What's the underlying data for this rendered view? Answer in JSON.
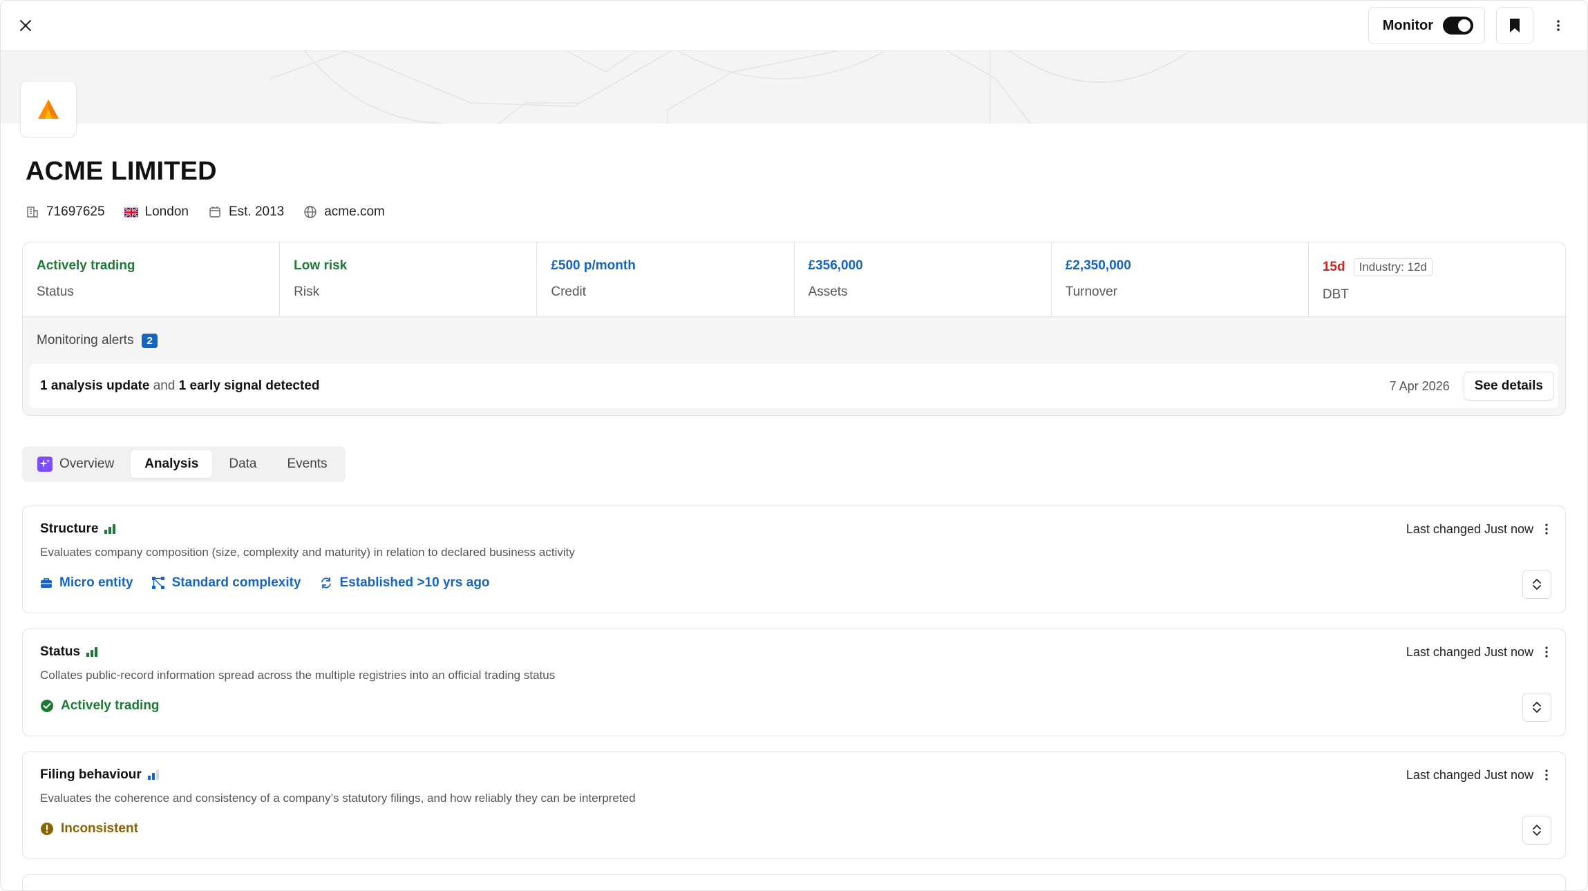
{
  "header": {
    "monitor_label": "Monitor"
  },
  "company": {
    "name": "ACME LIMITED",
    "number": "71697625",
    "location": "London",
    "established": "Est. 2013",
    "website": "acme.com"
  },
  "kpis": [
    {
      "value": "Actively trading",
      "label": "Status",
      "color": "#1d7a35"
    },
    {
      "value": "Low risk",
      "label": "Risk",
      "color": "#1d7a35"
    },
    {
      "value": "£500 p/month",
      "label": "Credit",
      "color": "#1565c0"
    },
    {
      "value": "£356,000",
      "label": "Assets",
      "color": "#1565c0"
    },
    {
      "value": "£2,350,000",
      "label": "Turnover",
      "color": "#1565c0"
    },
    {
      "value": "15d",
      "badge": "Industry: 12d",
      "label": "DBT",
      "color": "#c62828"
    }
  ],
  "alerts": {
    "title": "Monitoring alerts",
    "count": "2",
    "part1": "1 analysis update",
    "joiner": "and",
    "part2": "1 early signal detected",
    "date": "7 Apr 2026",
    "button": "See details"
  },
  "tabs": [
    {
      "label": "Overview",
      "icon": "sparkle-icon"
    },
    {
      "label": "Analysis",
      "active": true
    },
    {
      "label": "Data"
    },
    {
      "label": "Events"
    }
  ],
  "cards": [
    {
      "title": "Structure",
      "last_changed": "Last changed Just now",
      "description": "Evaluates company composition (size, complexity and maturity) in relation to declared business activity",
      "tags": [
        {
          "icon": "briefcase-icon",
          "label": "Micro entity"
        },
        {
          "icon": "network-icon",
          "label": "Standard complexity"
        },
        {
          "icon": "refresh-icon",
          "label": "Established >10 yrs ago"
        }
      ]
    },
    {
      "title": "Status",
      "last_changed": "Last changed Just now",
      "description": "Collates public-record information spread across the multiple registries into an official trading status",
      "result": "Actively trading"
    },
    {
      "title": "Filing behaviour",
      "last_changed": "Last changed Just now",
      "description": "Evaluates the coherence and consistency of a company’s statutory filings, and how reliably they can be interpreted",
      "result": "Inconsistent"
    }
  ],
  "colors": {
    "accent_blue": "#1565c0",
    "positive_green": "#1d7a35",
    "warning_amber": "#8a6400",
    "negative_red": "#c62828"
  }
}
